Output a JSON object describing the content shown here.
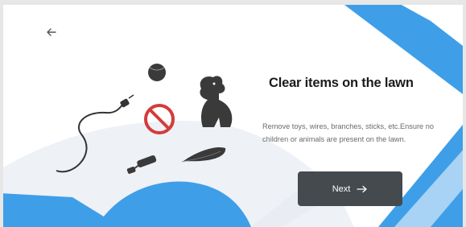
{
  "icons": {
    "back": "arrow-left-icon",
    "next": "arrow-right-icon"
  },
  "illustration": {
    "items": [
      "ball-icon",
      "dog-icon",
      "cable-icon",
      "no-symbol-icon",
      "toy-icon",
      "leaf-icon"
    ]
  },
  "main": {
    "title": "Clear items on the lawn",
    "description": "Remove toys, wires, branches, sticks, etc.Ensure no children or animals are present on the lawn."
  },
  "next_button": {
    "label": "Next"
  },
  "colors": {
    "accent_blue": "#3f9ee8",
    "button_bg": "#444a4e",
    "prohibit_red": "#d43b3b"
  }
}
